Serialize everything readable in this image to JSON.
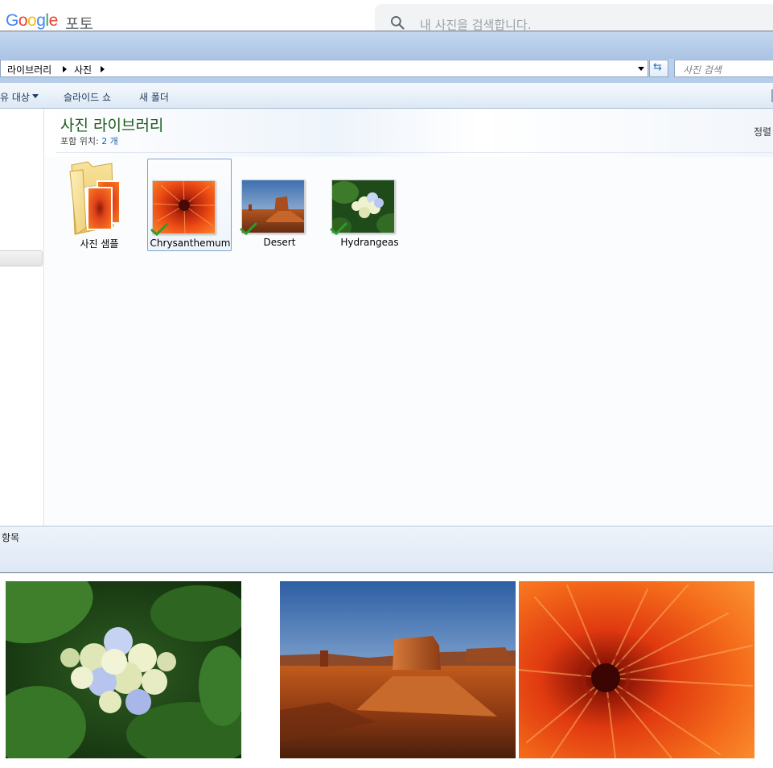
{
  "google_photos": {
    "logo_text": "Google",
    "product_name": "포토",
    "search_placeholder": "내 사진을 검색합니다."
  },
  "explorer": {
    "breadcrumbs": [
      "라이브러리",
      "사진"
    ],
    "search_placeholder": "사진 검색",
    "toolbar": {
      "share_label": "유 대상",
      "slideshow_label": "슬라이드 쇼",
      "new_folder_label": "새 폴더"
    },
    "library": {
      "title": "사진 라이브러리",
      "includes_label": "포함 위치:",
      "includes_count": "2 개",
      "sort_label": "정렬"
    },
    "files": [
      {
        "name": "사진 샘플",
        "type": "folder",
        "selected": false,
        "synced": false
      },
      {
        "name": "Chrysanthemum",
        "type": "image",
        "selected": true,
        "synced": true
      },
      {
        "name": "Desert",
        "type": "image",
        "selected": false,
        "synced": true
      },
      {
        "name": "Hydrangeas",
        "type": "image",
        "selected": false,
        "synced": true
      }
    ],
    "status_text": "항목"
  },
  "gallery": {
    "photos": [
      "Hydrangeas",
      "Desert",
      "Chrysanthemum"
    ]
  },
  "colors": {
    "explorer_chrome": "#c4d7ee",
    "library_title": "#1e5b1e",
    "check_green": "#2a9d2a",
    "google_search_bg": "#f1f3f4"
  }
}
